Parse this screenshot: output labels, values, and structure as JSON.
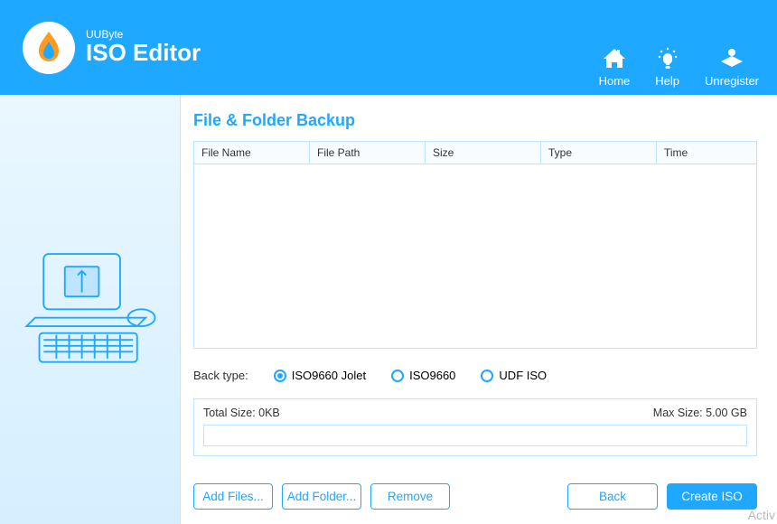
{
  "titlebar": {
    "dropdown": "▾",
    "minimize": "—",
    "close": "✕"
  },
  "header": {
    "brand": "UUByte",
    "product": "ISO Editor",
    "nav": {
      "home": "Home",
      "help": "Help",
      "unregister": "Unregister"
    }
  },
  "page": {
    "title": "File & Folder Backup",
    "columns": {
      "name": "File Name",
      "path": "File Path",
      "size": "Size",
      "type": "Type",
      "time": "Time"
    },
    "rows": []
  },
  "backtype": {
    "label": "Back type:",
    "options": {
      "iso9660jolet": "ISO9660 Jolet",
      "iso9660": "ISO9660",
      "udf": "UDF ISO"
    },
    "selected": "iso9660jolet"
  },
  "sizebox": {
    "total": "Total Size: 0KB",
    "max": "Max Size: 5.00 GB"
  },
  "buttons": {
    "addFiles": "Add Files...",
    "addFolder": "Add Folder...",
    "remove": "Remove",
    "back": "Back",
    "create": "Create ISO"
  },
  "watermark": "Activ"
}
